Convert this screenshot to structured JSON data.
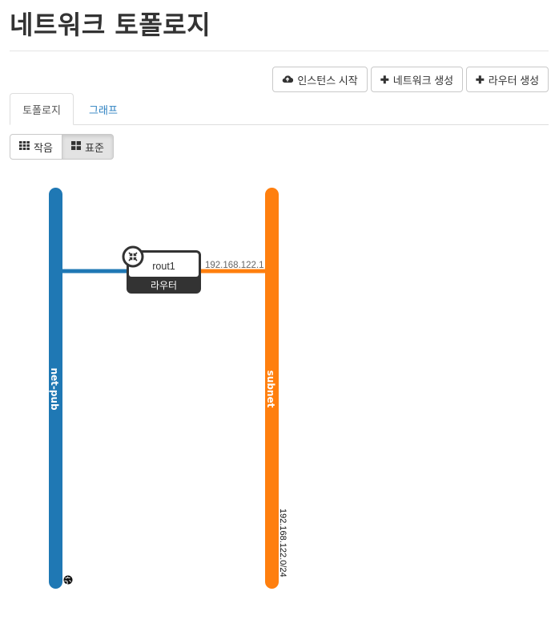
{
  "page": {
    "title": "네트워크 토폴로지"
  },
  "actions": {
    "launch_instance": "인스턴스 시작",
    "create_network": "네트워크 생성",
    "create_router": "라우터 생성"
  },
  "tabs": [
    {
      "label": "토폴로지",
      "active": true
    },
    {
      "label": "그래프",
      "active": false
    }
  ],
  "view_toggle": {
    "small": "작음",
    "normal": "표준",
    "selected": "표준"
  },
  "topology": {
    "networks": [
      {
        "name": "net-pub",
        "color": "#1f78b4",
        "external": true,
        "cidr": ""
      },
      {
        "name": "subnet",
        "color": "#ff7f0e",
        "external": false,
        "cidr": "192.168.122.0/24"
      }
    ],
    "router": {
      "name": "rout1",
      "type_label": "라우터",
      "port_ip": "192.168.122.1"
    }
  },
  "colors": {
    "link": "#2a7fc0",
    "dark": "#333333"
  }
}
